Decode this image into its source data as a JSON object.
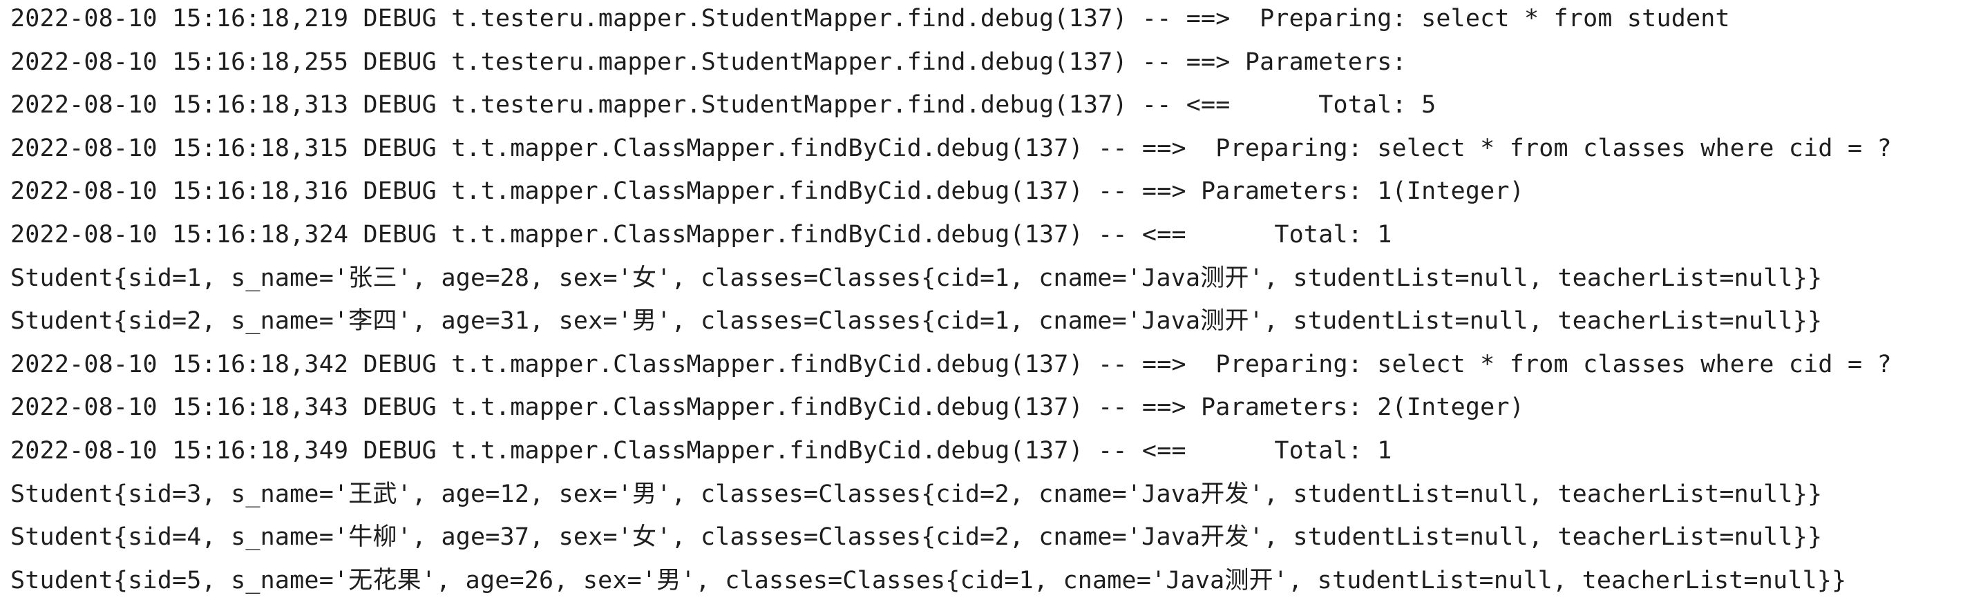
{
  "console": {
    "lines": [
      "2022-08-10 15:16:18,219 DEBUG t.testeru.mapper.StudentMapper.find.debug(137) -- ==>  Preparing: select * from student",
      "2022-08-10 15:16:18,255 DEBUG t.testeru.mapper.StudentMapper.find.debug(137) -- ==> Parameters: ",
      "2022-08-10 15:16:18,313 DEBUG t.testeru.mapper.StudentMapper.find.debug(137) -- <==      Total: 5",
      "2022-08-10 15:16:18,315 DEBUG t.t.mapper.ClassMapper.findByCid.debug(137) -- ==>  Preparing: select * from classes where cid = ?",
      "2022-08-10 15:16:18,316 DEBUG t.t.mapper.ClassMapper.findByCid.debug(137) -- ==> Parameters: 1(Integer)",
      "2022-08-10 15:16:18,324 DEBUG t.t.mapper.ClassMapper.findByCid.debug(137) -- <==      Total: 1",
      "Student{sid=1, s_name='张三', age=28, sex='女', classes=Classes{cid=1, cname='Java测开', studentList=null, teacherList=null}}",
      "Student{sid=2, s_name='李四', age=31, sex='男', classes=Classes{cid=1, cname='Java测开', studentList=null, teacherList=null}}",
      "2022-08-10 15:16:18,342 DEBUG t.t.mapper.ClassMapper.findByCid.debug(137) -- ==>  Preparing: select * from classes where cid = ?",
      "2022-08-10 15:16:18,343 DEBUG t.t.mapper.ClassMapper.findByCid.debug(137) -- ==> Parameters: 2(Integer)",
      "2022-08-10 15:16:18,349 DEBUG t.t.mapper.ClassMapper.findByCid.debug(137) -- <==      Total: 1",
      "Student{sid=3, s_name='王武', age=12, sex='男', classes=Classes{cid=2, cname='Java开发', studentList=null, teacherList=null}}",
      "Student{sid=4, s_name='牛柳', age=37, sex='女', classes=Classes{cid=2, cname='Java开发', studentList=null, teacherList=null}}",
      "Student{sid=5, s_name='无花果', age=26, sex='男', classes=Classes{cid=1, cname='Java测开', studentList=null, teacherList=null}}"
    ]
  }
}
